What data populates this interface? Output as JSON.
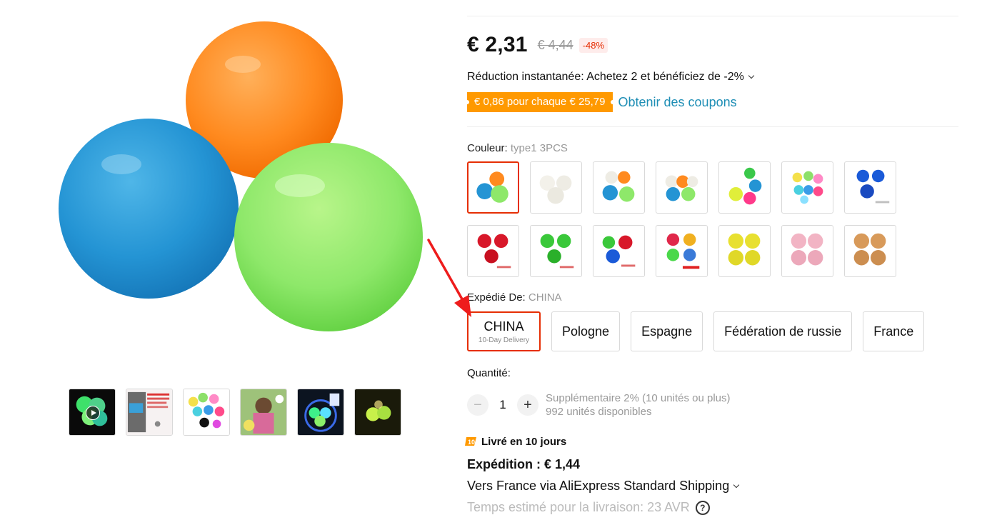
{
  "gallery": {
    "main_image_alt": "",
    "thumbnails": [
      {
        "name": "video-thumbnail"
      },
      {
        "name": "info-thumbnail"
      },
      {
        "name": "colors-thumbnail"
      },
      {
        "name": "kids-thumbnail"
      },
      {
        "name": "glow-thumbnail"
      },
      {
        "name": "glow-dark-thumbnail"
      }
    ]
  },
  "price": {
    "current": "€ 2,31",
    "original": "€ 4,44",
    "discount": "-48%"
  },
  "instant_discount": "Réduction instantanée: Achetez 2 et bénéficiez de -2%",
  "coupon": {
    "tag": "€ 0,86 pour chaque € 25,79",
    "link": "Obtenir des coupons"
  },
  "color": {
    "label": "Couleur:",
    "selected": "type1 3PCS"
  },
  "ship_from": {
    "label": "Expédié De:",
    "selected": "CHINA",
    "options": [
      {
        "label": "CHINA",
        "sub": "10-Day Delivery"
      },
      {
        "label": "Pologne",
        "sub": ""
      },
      {
        "label": "Espagne",
        "sub": ""
      },
      {
        "label": "Fédération de russie",
        "sub": ""
      },
      {
        "label": "France",
        "sub": ""
      }
    ]
  },
  "quantity": {
    "label": "Quantité:",
    "value": "1",
    "minus": "−",
    "plus": "+",
    "extra": "Supplémentaire 2% (10 unités ou plus)",
    "available": "992 unités disponibles"
  },
  "delivery": {
    "text": "Livré en 10 jours",
    "shipping_cost": "Expédition : € 1,44",
    "via": "Vers France via AliExpress Standard Shipping",
    "estimated": "Temps estimé pour la livraison: 23 AVR",
    "help": "?"
  },
  "colors": {
    "accent": "#e62e04",
    "coupon_bg": "#ff9900",
    "link": "#1e8eb5",
    "annotation_arrow": "#ee1c1c"
  }
}
